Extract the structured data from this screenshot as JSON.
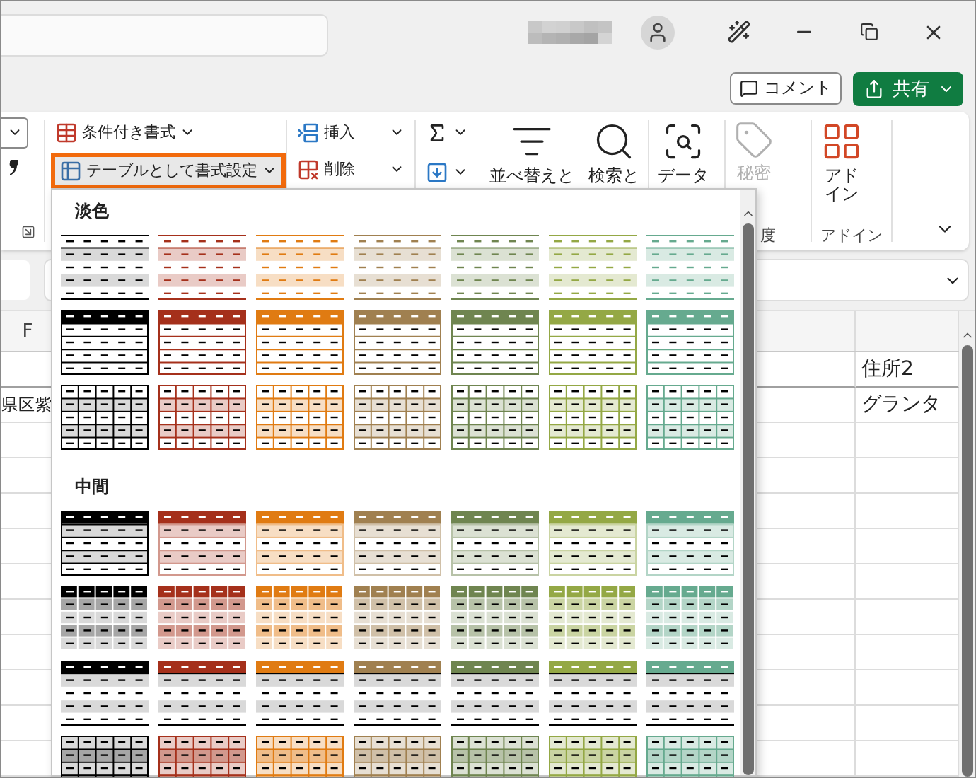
{
  "title_bar": {
    "comment_button": "コメント",
    "share_button": "共有"
  },
  "ribbon": {
    "styles": [
      {
        "kind": "conditional",
        "label": "条件付き書式",
        "highlighted": false
      },
      {
        "kind": "table",
        "label": "テーブルとして書式設定",
        "highlighted": true
      }
    ],
    "cells": [
      {
        "kind": "insert",
        "label": "挿入"
      },
      {
        "kind": "delete",
        "label": "削除"
      }
    ],
    "editing": {
      "sort": "並べ替えと",
      "find": "検索と"
    },
    "data_analysis": "データ",
    "sensitivity": {
      "label": "秘密",
      "group": "度"
    },
    "addins": {
      "label": "アドイン",
      "group": "アドイン"
    }
  },
  "gallery": {
    "sections": [
      {
        "label": "淡色",
        "rows": [
          {
            "kind": "banded-lines",
            "items": [
              {
                "color": "#000000"
              },
              {
                "color": "#a5301b"
              },
              {
                "color": "#e07b12"
              },
              {
                "color": "#a08050"
              },
              {
                "color": "#6f8550"
              },
              {
                "color": "#94a845"
              },
              {
                "color": "#66aa8f"
              }
            ]
          },
          {
            "kind": "header-rows",
            "items": [
              {
                "color": "#000000"
              },
              {
                "color": "#a5301b"
              },
              {
                "color": "#e07b12"
              },
              {
                "color": "#a08050"
              },
              {
                "color": "#6f8550"
              },
              {
                "color": "#94a845"
              },
              {
                "color": "#66aa8f"
              }
            ]
          },
          {
            "kind": "grid-banded",
            "items": [
              {
                "color": "#000000"
              },
              {
                "color": "#a5301b"
              },
              {
                "color": "#e07b12"
              },
              {
                "color": "#a08050"
              },
              {
                "color": "#6f8550"
              },
              {
                "color": "#94a845"
              },
              {
                "color": "#66aa8f"
              }
            ]
          }
        ]
      },
      {
        "label": "中間",
        "rows": [
          {
            "kind": "header-banded",
            "items": [
              {
                "color": "#000000"
              },
              {
                "color": "#a5301b"
              },
              {
                "color": "#e07b12"
              },
              {
                "color": "#a08050"
              },
              {
                "color": "#6f8550"
              },
              {
                "color": "#94a845"
              },
              {
                "color": "#66aa8f"
              }
            ]
          },
          {
            "kind": "header-cells",
            "items": [
              {
                "color": "#000000"
              },
              {
                "color": "#a5301b"
              },
              {
                "color": "#e07b12"
              },
              {
                "color": "#a08050"
              },
              {
                "color": "#6f8550"
              },
              {
                "color": "#94a845"
              },
              {
                "color": "#66aa8f"
              }
            ]
          },
          {
            "kind": "header-gray-bands",
            "items": [
              {
                "color": "#000000"
              },
              {
                "color": "#a5301b"
              },
              {
                "color": "#e07b12"
              },
              {
                "color": "#a08050"
              },
              {
                "color": "#6f8550"
              },
              {
                "color": "#94a845"
              },
              {
                "color": "#66aa8f"
              }
            ]
          },
          {
            "kind": "grid-tinted",
            "items": [
              {
                "color": "#000000"
              },
              {
                "color": "#a5301b"
              },
              {
                "color": "#e07b12"
              },
              {
                "color": "#a08050"
              },
              {
                "color": "#6f8550"
              },
              {
                "color": "#94a845"
              },
              {
                "color": "#66aa8f"
              }
            ]
          }
        ]
      }
    ]
  },
  "sheet": {
    "column_header": "F",
    "rows": [
      {
        "right_column": "住所2"
      },
      {
        "column_f": "県区紫",
        "right_column": "グランタ"
      }
    ]
  }
}
